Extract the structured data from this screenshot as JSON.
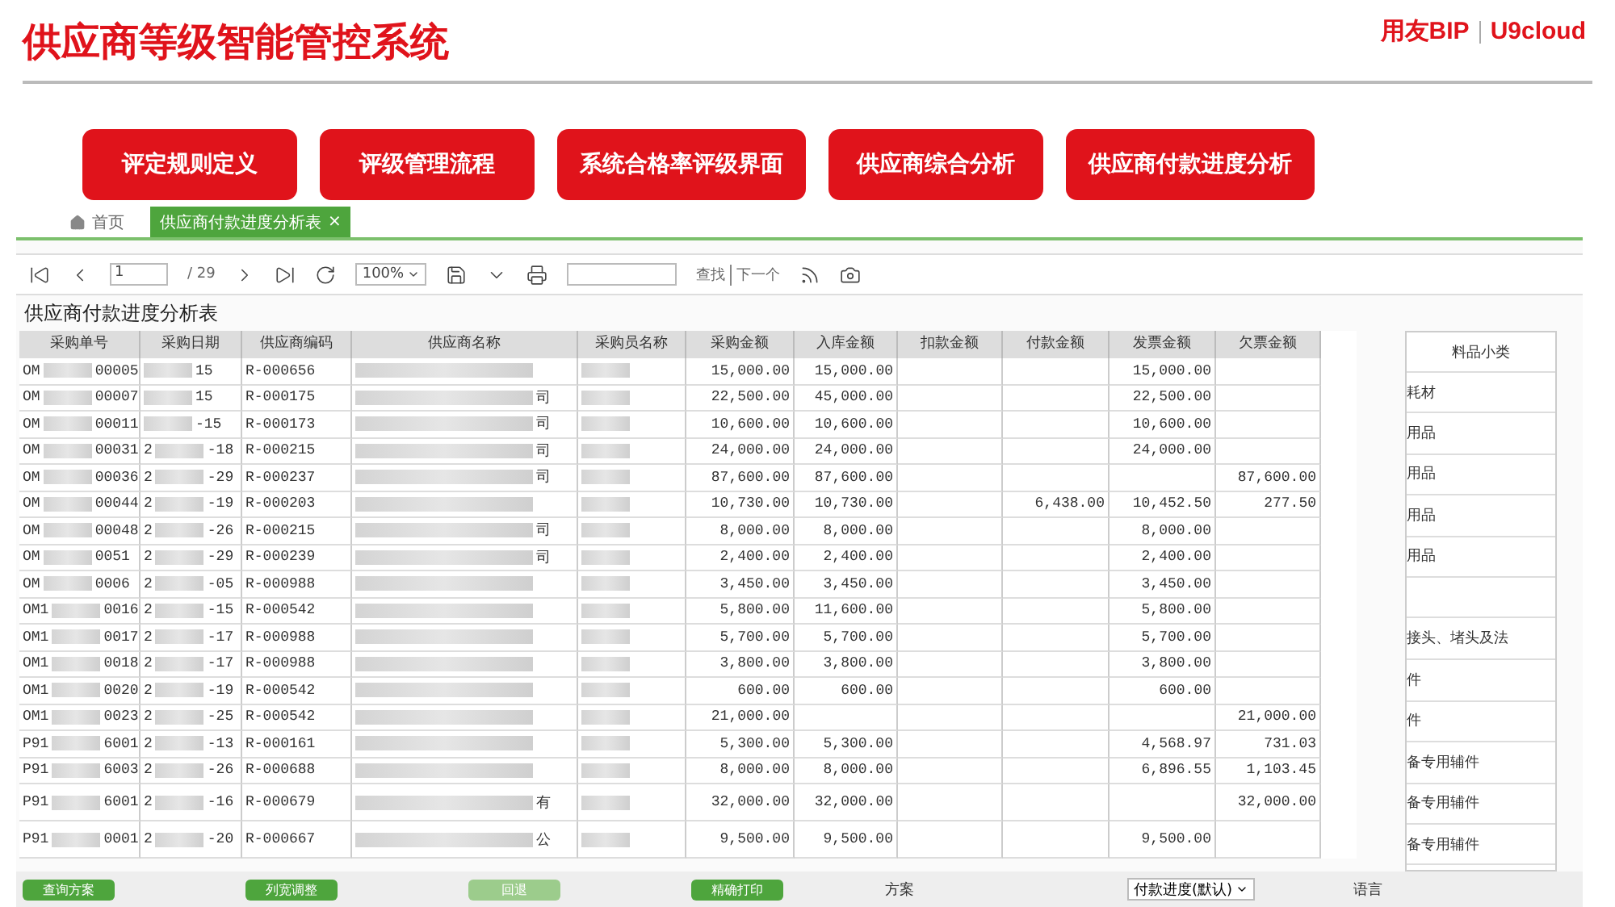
{
  "header": {
    "title": "供应商等级智能管控系统",
    "logo_main": "用友BIP",
    "logo_sub": "U9cloud"
  },
  "nav_buttons": [
    "评定规则定义",
    "评级管理流程",
    "系统合格率评级界面",
    "供应商综合分析",
    "供应商付款进度分析"
  ],
  "tabs": [
    {
      "label": "首页",
      "kind": "home",
      "selected": false
    },
    {
      "label": "供应商付款进度分析表",
      "kind": "page",
      "selected": true,
      "close": "×"
    }
  ],
  "toolbar": {
    "page": "1",
    "page_total": "/ 29",
    "zoom": "100%",
    "find": "查找",
    "next": "下一个"
  },
  "report": {
    "title": "供应商付款进度分析表",
    "columns": [
      "采购单号",
      "采购日期",
      "供应商编码",
      "供应商名称",
      "采购员名称",
      "采购金额",
      "入库金额",
      "扣款金额",
      "付款金额",
      "发票金额",
      "欠票金额"
    ],
    "rows": [
      {
        "order": [
          "OM",
          "00005"
        ],
        "date_suffix": "15",
        "code": "R-000656",
        "purchase": "15,000.00",
        "received": "15,000.00",
        "invoiced": "15,000.00",
        "tall": false
      },
      {
        "order": [
          "OM",
          "00007"
        ],
        "date_suffix": "15",
        "code": "R-000175",
        "name_tail": "司",
        "purchase": "22,500.00",
        "received": "45,000.00",
        "invoiced": "22,500.00",
        "tall": false
      },
      {
        "order": [
          "OM",
          "00011"
        ],
        "date_suffix": "-15",
        "code": "R-000173",
        "name_tail": "司",
        "purchase": "10,600.00",
        "received": "10,600.00",
        "invoiced": "10,600.00",
        "tall": false
      },
      {
        "order": [
          "OM",
          "00031"
        ],
        "date_prefix": "2",
        "date_suffix": "-18",
        "code": "R-000215",
        "name_tail": "司",
        "purchase": "24,000.00",
        "received": "24,000.00",
        "invoiced": "24,000.00",
        "tall": false
      },
      {
        "order": [
          "OM",
          "00036"
        ],
        "date_prefix": "2",
        "date_suffix": "-29",
        "code": "R-000237",
        "name_tail": "司",
        "purchase": "87,600.00",
        "received": "87,600.00",
        "uninvoiced": "87,600.00",
        "tall": false
      },
      {
        "order": [
          "OM",
          "00044"
        ],
        "date_prefix": "2",
        "date_suffix": "-19",
        "code": "R-000203",
        "purchase": "10,730.00",
        "received": "10,730.00",
        "paid": "6,438.00",
        "invoiced": "10,452.50",
        "uninvoiced": "277.50",
        "tall": false
      },
      {
        "order": [
          "OM",
          "00048"
        ],
        "date_prefix": "2",
        "date_suffix": "-26",
        "code": "R-000215",
        "name_tail": "司",
        "purchase": "8,000.00",
        "received": "8,000.00",
        "invoiced": "8,000.00",
        "tall": false
      },
      {
        "order": [
          "OM",
          "0051"
        ],
        "date_prefix": "2",
        "date_suffix": "-29",
        "code": "R-000239",
        "name_tail": "司",
        "purchase": "2,400.00",
        "received": "2,400.00",
        "invoiced": "2,400.00",
        "tall": false
      },
      {
        "order": [
          "OM",
          "0006"
        ],
        "date_prefix": "2",
        "date_suffix": "-05",
        "code": "R-000988",
        "purchase": "3,450.00",
        "received": "3,450.00",
        "invoiced": "3,450.00",
        "tall": false
      },
      {
        "order": [
          "OM1",
          "0016"
        ],
        "date_prefix": "2",
        "date_suffix": "-15",
        "code": "R-000542",
        "purchase": "5,800.00",
        "received": "11,600.00",
        "invoiced": "5,800.00",
        "tall": false
      },
      {
        "order": [
          "OM1",
          "0017"
        ],
        "date_prefix": "2",
        "date_suffix": "-17",
        "code": "R-000988",
        "purchase": "5,700.00",
        "received": "5,700.00",
        "invoiced": "5,700.00",
        "tall": false
      },
      {
        "order": [
          "OM1",
          "0018"
        ],
        "date_prefix": "2",
        "date_suffix": "-17",
        "code": "R-000988",
        "purchase": "3,800.00",
        "received": "3,800.00",
        "invoiced": "3,800.00",
        "tall": false
      },
      {
        "order": [
          "OM1",
          "0020"
        ],
        "date_prefix": "2",
        "date_suffix": "-19",
        "code": "R-000542",
        "purchase": "600.00",
        "received": "600.00",
        "invoiced": "600.00",
        "tall": false
      },
      {
        "order": [
          "OM1",
          "0023"
        ],
        "date_prefix": "2",
        "date_suffix": "-25",
        "code": "R-000542",
        "purchase": "21,000.00",
        "uninvoiced": "21,000.00",
        "tall": false
      },
      {
        "order": [
          "P91",
          "6001"
        ],
        "date_prefix": "2",
        "date_suffix": "-13",
        "code": "R-000161",
        "purchase": "5,300.00",
        "received": "5,300.00",
        "invoiced": "4,568.97",
        "uninvoiced": "731.03",
        "tall": false
      },
      {
        "order": [
          "P91",
          "6003"
        ],
        "date_prefix": "2",
        "date_suffix": "-26",
        "code": "R-000688",
        "purchase": "8,000.00",
        "received": "8,000.00",
        "invoiced": "6,896.55",
        "uninvoiced": "1,103.45",
        "tall": false
      },
      {
        "order": [
          "P91",
          "6001"
        ],
        "date_prefix": "2",
        "date_suffix": "-16",
        "code": "R-000679",
        "name_tail": "有",
        "purchase": "32,000.00",
        "received": "32,000.00",
        "uninvoiced": "32,000.00",
        "tall": true
      },
      {
        "order": [
          "P91",
          "0001"
        ],
        "date_prefix": "2",
        "date_suffix": "-20",
        "code": "R-000667",
        "name_tail": "公",
        "purchase": "9,500.00",
        "received": "9,500.00",
        "invoiced": "9,500.00",
        "tall": true
      }
    ]
  },
  "side_panel": {
    "header": "料品小类",
    "items": [
      {
        "kind": "text",
        "text": "耗材"
      },
      {
        "kind": "text",
        "text": "用品"
      },
      {
        "kind": "text",
        "text": "用品"
      },
      {
        "kind": "text",
        "text": "用品"
      },
      {
        "kind": "text",
        "text": "用品"
      },
      {
        "kind": "blank"
      },
      {
        "kind": "text",
        "text": "接头、堵头及法"
      },
      {
        "kind": "text",
        "text": "件"
      },
      {
        "kind": "text",
        "text": "件"
      },
      {
        "kind": "text",
        "text": "备专用辅件"
      },
      {
        "kind": "text",
        "text": "备专用辅件"
      },
      {
        "kind": "text",
        "text": "备专用辅件"
      }
    ],
    "footer": "语言"
  },
  "bottom_bar": {
    "buttons": [
      {
        "label": "查询方案",
        "disabled": false
      },
      {
        "label": "列宽调整",
        "disabled": false
      },
      {
        "label": "回退",
        "disabled": true
      },
      {
        "label": "精确打印",
        "disabled": false
      }
    ],
    "scheme_label": "方案",
    "scheme_value": "付款进度(默认)"
  }
}
